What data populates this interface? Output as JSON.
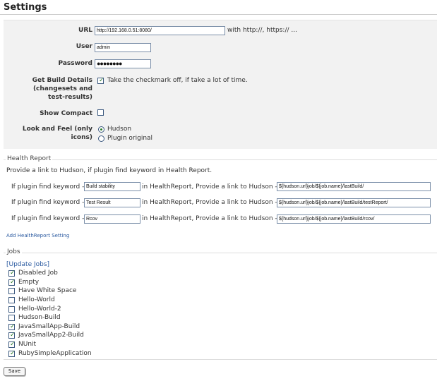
{
  "page": {
    "title": "Settings"
  },
  "settings": {
    "url_label": "URL",
    "url_value": "http://192.168.0.51:8080/",
    "url_hint": "with http://, https:// ...",
    "user_label": "User",
    "user_value": "admin",
    "password_label": "Password",
    "password_value": "●●●●●●●●",
    "build_details_label": [
      "Get Build Details",
      "(changesets and",
      "test-results)"
    ],
    "build_details_checked": true,
    "build_details_hint": "Take the checkmark off, if take a lot of time.",
    "show_compact_label": "Show Compact",
    "show_compact_checked": false,
    "look_label": [
      "Look and Feel (only",
      "icons)"
    ],
    "look_options": [
      {
        "label": "Hudson",
        "selected": true
      },
      {
        "label": "Plugin original",
        "selected": false
      }
    ]
  },
  "health": {
    "legend": "Health Report",
    "description": "Provide a link to Hudson, if plugin find keyword in Health Report.",
    "row_prefix": "If plugin find keyword -",
    "row_middle": "in HealthReport, Provide a link to Hudson -",
    "rows": [
      {
        "keyword": "Build stability",
        "link": "${hudson.url}job/${job.name}/lastBuild/"
      },
      {
        "keyword": "Test Result",
        "link": "${hudson.url}job/${job.name}/lastBuild/testReport/"
      },
      {
        "keyword": "Rcov",
        "link": "${hudson.url}job/${job.name}/lastBuild/rcov/"
      }
    ],
    "add_link": "Add HealthReport Setting"
  },
  "jobs": {
    "legend": "Jobs",
    "update_link": "[Update Jobs]",
    "items": [
      {
        "name": "Disabled Job",
        "checked": true
      },
      {
        "name": "Empty",
        "checked": true
      },
      {
        "name": "Have White Space",
        "checked": false
      },
      {
        "name": "Hello-World",
        "checked": false
      },
      {
        "name": "Hello-World-2",
        "checked": false
      },
      {
        "name": "Hudson-Build",
        "checked": false
      },
      {
        "name": "JavaSmallApp-Build",
        "checked": true
      },
      {
        "name": "JavaSmallApp2-Build",
        "checked": true
      },
      {
        "name": "NUnit",
        "checked": true
      },
      {
        "name": "RubySimpleApplication",
        "checked": true
      }
    ]
  },
  "footer": {
    "save_label": "Save"
  }
}
